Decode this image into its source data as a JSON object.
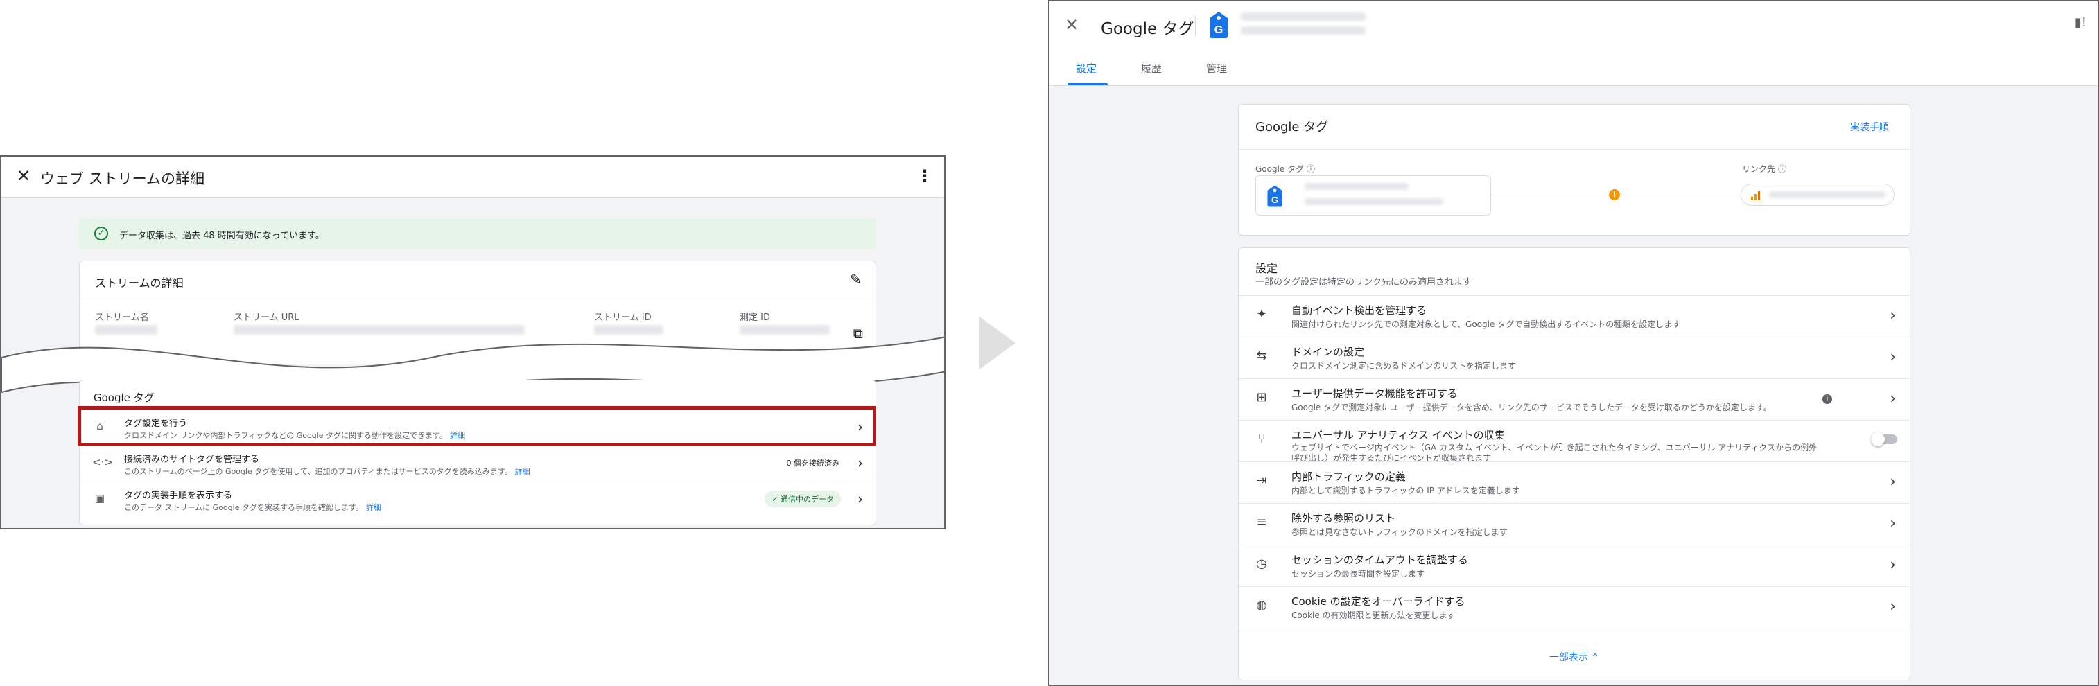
{
  "left": {
    "title": "ウェブ ストリームの詳細",
    "banner": "データ収集は、過去 48 時間有効になっています。",
    "stream_details": {
      "heading": "ストリームの詳細",
      "labels": [
        "ストリーム名",
        "ストリーム URL",
        "ストリーム ID",
        "測定 ID"
      ]
    },
    "google_tag": {
      "heading": "Google タグ",
      "rows": [
        {
          "title": "タグ設定を行う",
          "desc": "クロスドメイン リンクや内部トラフィックなどの Google タグに関する動作を設定できます。",
          "link": "詳細"
        },
        {
          "title": "接続済みのサイトタグを管理する",
          "desc": "このストリームのページ上の Google タグを使用して、追加のプロパティまたはサービスのタグを読み込みます。",
          "link": "詳細",
          "meta": "0 個を接続済み"
        },
        {
          "title": "タグの実装手順を表示する",
          "desc": "このデータ ストリームに Google タグを実装する手順を確認します。",
          "link": "詳細",
          "badge": "✓ 通信中のデータ"
        }
      ]
    },
    "highlight_color": "#b21a1a"
  },
  "right": {
    "title": "Google タグ",
    "tabs": [
      "設定",
      "履歴",
      "管理"
    ],
    "active_tab": "設定",
    "tag_card": {
      "heading": "Google タグ",
      "instructions_link": "実装手順",
      "google_tag_label": "Google タグ ⓘ",
      "linked_label": "リンク先 ⓘ"
    },
    "settings": {
      "heading": "設定",
      "subheading": "一部のタグ設定は特定のリンク先にのみ適用されます",
      "rows": [
        {
          "icon": "sparkle-icon",
          "glyph": "✦",
          "title": "自動イベント検出を管理する",
          "desc": "関連付けられたリンク先での測定対象として、Google タグで自動検出するイベントの種類を設定します"
        },
        {
          "icon": "cross-domain-icon",
          "glyph": "⇆",
          "title": "ドメインの設定",
          "desc": "クロスドメイン測定に含めるドメインのリストを指定します"
        },
        {
          "icon": "user-data-icon",
          "glyph": "⊞",
          "title": "ユーザー提供データ機能を許可する",
          "desc": "Google タグで測定対象にユーザー提供データを含め、リンク先のサービスでそうしたデータを受け取るかどうかを設定します。"
        },
        {
          "icon": "merge-icon",
          "glyph": "⑂",
          "title": "ユニバーサル アナリティクス イベントの収集",
          "desc": "ウェブサイトでページ内イベント（GA カスタム イベント、イベントが引き起こされたタイミング、ユニバーサル アナリティクスからの例外",
          "desc2": "呼び出し）が発生するたびにイベントが収集されます"
        },
        {
          "icon": "internal-traffic-icon",
          "glyph": "⇥",
          "title": "内部トラフィックの定義",
          "desc": "内部として識別するトラフィックの IP アドレスを定義します"
        },
        {
          "icon": "exclude-list-icon",
          "glyph": "≡",
          "title": "除外する参照のリスト",
          "desc": "参照とは見なさないトラフィックのドメインを指定します"
        },
        {
          "icon": "clock-icon",
          "glyph": "◷",
          "title": "セッションのタイムアウトを調整する",
          "desc": "セッションの最長時間を設定します"
        },
        {
          "icon": "cookie-icon",
          "glyph": "◍",
          "title": "Cookie の設定をオーバーライドする",
          "desc": "Cookie の有効期限と更新方法を変更します"
        }
      ],
      "show_less": "一部表示 ⌃"
    },
    "accent_color": "#1a73e8"
  }
}
